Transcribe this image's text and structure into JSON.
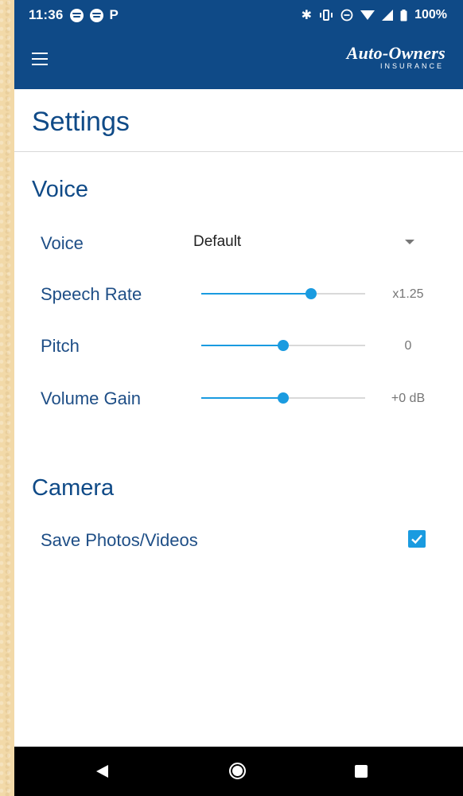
{
  "status_bar": {
    "time": "11:36",
    "left_icons": [
      "spotify-icon",
      "spotify-icon",
      "pandora-icon"
    ],
    "right_icons": [
      "bluetooth-icon",
      "vibrate-icon",
      "do-not-disturb-icon",
      "wifi-icon",
      "cell-signal-icon",
      "battery-icon"
    ],
    "battery": "100%"
  },
  "app_bar": {
    "menu_icon": "hamburger-menu-icon",
    "logo_brand": "Auto-Owners",
    "logo_sub": "INSURANCE"
  },
  "page": {
    "title": "Settings"
  },
  "voice_section": {
    "title": "Voice",
    "voice": {
      "label": "Voice",
      "value": "Default"
    },
    "speech_rate": {
      "label": "Speech Rate",
      "value": "x1.25",
      "position": 0.67
    },
    "pitch": {
      "label": "Pitch",
      "value": "0",
      "position": 0.5
    },
    "volume_gain": {
      "label": "Volume Gain",
      "value": "+0 dB",
      "position": 0.5
    }
  },
  "camera_section": {
    "title": "Camera",
    "save_media": {
      "label": "Save Photos/Videos",
      "checked": true
    }
  },
  "colors": {
    "brand_blue": "#0f4a87",
    "accent": "#1a9be0"
  }
}
